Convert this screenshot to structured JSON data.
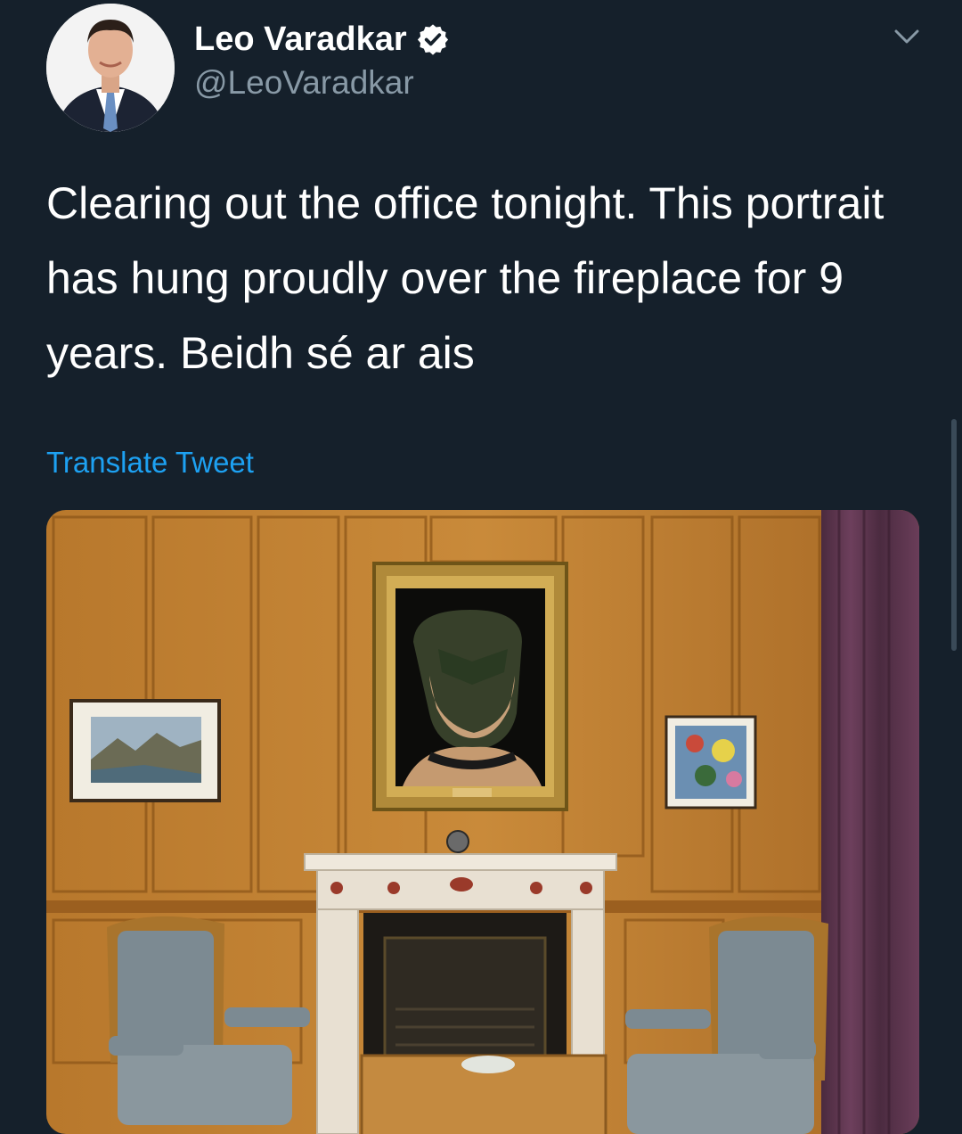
{
  "author": {
    "display_name": "Leo Varadkar",
    "handle": "@LeoVaradkar",
    "verified_icon": "verified-badge-icon"
  },
  "tweet": {
    "text": "Clearing out the office tonight. This portrait has hung proudly over the fireplace for 9 years. Beidh sé ar ais",
    "translate_label": "Translate Tweet"
  },
  "icons": {
    "more": "chevron-down-icon"
  },
  "colors": {
    "background": "#15202b",
    "text": "#ffffff",
    "secondary_text": "#8899a6",
    "link": "#1da1f2"
  }
}
